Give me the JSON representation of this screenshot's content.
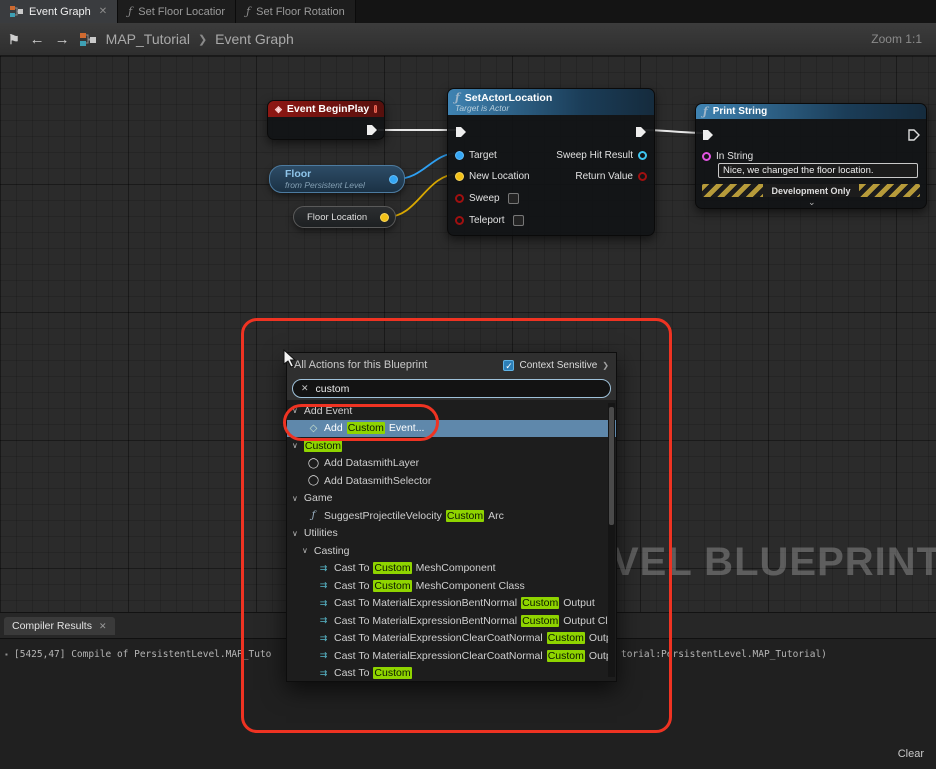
{
  "colors": {
    "annotation_red": "#ef3322",
    "highlight_green": "#8fd400",
    "selection_blue": "#5f88ab",
    "pin_blue": "#35a7f5",
    "pin_gold": "#f2c117",
    "pin_red": "#a01010",
    "pin_magenta": "#e254e2",
    "exec_white": "#e8e8e8",
    "header_blue": "#3f83b2",
    "header_red": "#8e1713"
  },
  "icons": {
    "close": "✕",
    "function": "ƒ",
    "back": "←",
    "forward": "→",
    "bookmark": "⚑",
    "chevron_sep": "❯",
    "check": "✓",
    "caret": "∨",
    "chevron_down": "⌄",
    "event_diamond": "◇",
    "object_circle": "◯",
    "cast": "⇉",
    "more": "❯",
    "bullet": "▪"
  },
  "tab_bar": {
    "tabs": [
      {
        "label": "Event Graph",
        "active": true
      },
      {
        "label": "Set Floor Locatior",
        "active": false
      },
      {
        "label": "Set Floor Rotation",
        "active": false
      }
    ]
  },
  "toolbar": {
    "breadcrumb_root": "MAP_Tutorial",
    "breadcrumb_current": "Event Graph",
    "zoom_label": "Zoom 1:1"
  },
  "graph": {
    "begin_play": {
      "title": "Event BeginPlay"
    },
    "set_actor_location": {
      "title": "SetActorLocation",
      "subtitle": "Target is Actor",
      "inputs": [
        "Target",
        "New Location",
        "Sweep",
        "Teleport"
      ],
      "outputs": [
        "Sweep Hit Result",
        "Return Value"
      ]
    },
    "print_string": {
      "title": "Print String",
      "pin_label": "In String",
      "string_value": "Nice, we changed the floor location.",
      "footer_label": "Development Only"
    },
    "floor_var": {
      "title": "Floor",
      "subtitle": "from Persistent Level"
    },
    "floor_location_var": {
      "title": "Floor Location"
    },
    "watermark": "VEL BLUEPRINT"
  },
  "context_menu": {
    "title": "All Actions for this Blueprint",
    "context_sensitive_label": "Context Sensitive",
    "search_value": "custom",
    "rows": [
      {
        "type": "category",
        "indent": 5,
        "segments": [
          {
            "t": "Add Event"
          }
        ]
      },
      {
        "type": "item",
        "icon": "event_diamond",
        "indent": 20,
        "selected": true,
        "segments": [
          {
            "t": "Add "
          },
          {
            "t": "Custom",
            "hl": true
          },
          {
            "t": " Event..."
          }
        ]
      },
      {
        "type": "category",
        "indent": 5,
        "segments": [
          {
            "t": "Custom",
            "hl": true
          }
        ]
      },
      {
        "type": "item",
        "icon": "object_circle",
        "indent": 20,
        "segments": [
          {
            "t": "Add DatasmithLayer"
          }
        ]
      },
      {
        "type": "item",
        "icon": "object_circle",
        "indent": 20,
        "segments": [
          {
            "t": "Add DatasmithSelector"
          }
        ]
      },
      {
        "type": "category",
        "indent": 5,
        "segments": [
          {
            "t": "Game"
          }
        ]
      },
      {
        "type": "item",
        "icon": "function",
        "indent": 20,
        "segments": [
          {
            "t": "SuggestProjectileVelocity "
          },
          {
            "t": "Custom",
            "hl": true
          },
          {
            "t": " Arc"
          }
        ]
      },
      {
        "type": "category",
        "indent": 5,
        "segments": [
          {
            "t": "Utilities"
          }
        ]
      },
      {
        "type": "category",
        "indent": 15,
        "segments": [
          {
            "t": "Casting"
          }
        ]
      },
      {
        "type": "item",
        "icon": "cast",
        "indent": 30,
        "segments": [
          {
            "t": "Cast To "
          },
          {
            "t": "Custom",
            "hl": true
          },
          {
            "t": "MeshComponent"
          }
        ]
      },
      {
        "type": "item",
        "icon": "cast",
        "indent": 30,
        "segments": [
          {
            "t": "Cast To "
          },
          {
            "t": "Custom",
            "hl": true
          },
          {
            "t": "MeshComponent Class"
          }
        ]
      },
      {
        "type": "item",
        "icon": "cast",
        "indent": 30,
        "segments": [
          {
            "t": "Cast To MaterialExpressionBentNormal"
          },
          {
            "t": "Custom",
            "hl": true
          },
          {
            "t": "Output"
          }
        ]
      },
      {
        "type": "item",
        "icon": "cast",
        "indent": 30,
        "segments": [
          {
            "t": "Cast To MaterialExpressionBentNormal"
          },
          {
            "t": "Custom",
            "hl": true
          },
          {
            "t": "Output Cla"
          }
        ]
      },
      {
        "type": "item",
        "icon": "cast",
        "indent": 30,
        "segments": [
          {
            "t": "Cast To MaterialExpressionClearCoatNormal"
          },
          {
            "t": "Custom",
            "hl": true
          },
          {
            "t": "Outp"
          }
        ]
      },
      {
        "type": "item",
        "icon": "cast",
        "indent": 30,
        "segments": [
          {
            "t": "Cast To MaterialExpressionClearCoatNormal"
          },
          {
            "t": "Custom",
            "hl": true
          },
          {
            "t": "Outp"
          }
        ]
      },
      {
        "type": "item",
        "icon": "cast",
        "indent": 30,
        "segments": [
          {
            "t": "Cast To "
          },
          {
            "t": "Custom",
            "hl": true
          }
        ]
      }
    ]
  },
  "compiler": {
    "tab_label": "Compiler Results",
    "log_left": "[5425,47] Compile of PersistentLevel.MAP_Tuto",
    "log_right": "torial:PersistentLevel.MAP_Tutorial)",
    "clear_label": "Clear"
  }
}
